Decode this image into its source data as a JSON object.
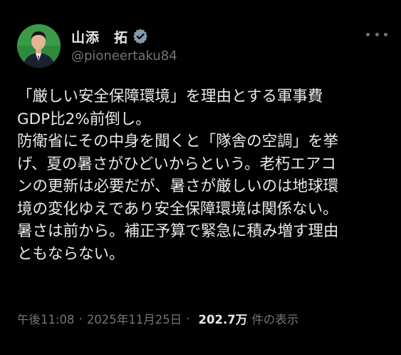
{
  "post": {
    "author": {
      "display_name": "山添　拓",
      "handle": "@pioneertaku84",
      "verified_icon": "verified-badge-icon",
      "avatar": "avatar-photo"
    },
    "more_icon": "more-options-icon",
    "text_lines": [
      "「厳しい安全保障環境」を理由とする軍事費",
      "GDP比2%前倒し。",
      "防衛省にその中身を聞くと「隊舎の空調」を挙",
      "げ、夏の暑さがひどいからという。老朽エアコ",
      "ンの更新は必要だが、暑さが厳しいのは地球環",
      "境の変化ゆえであり安全保障環境は関係ない。",
      "暑さは前から。補正予算で緊急に積み増す理由",
      "ともならない。"
    ],
    "meta": {
      "time": "午後11:08",
      "date": "2025年11月25日",
      "separator": "·",
      "views": "202.7万",
      "views_label": "件の表示"
    }
  },
  "colors": {
    "background": "#000000",
    "text": "#e7e9ea",
    "secondary": "#71767b",
    "verified": "#829aab"
  }
}
